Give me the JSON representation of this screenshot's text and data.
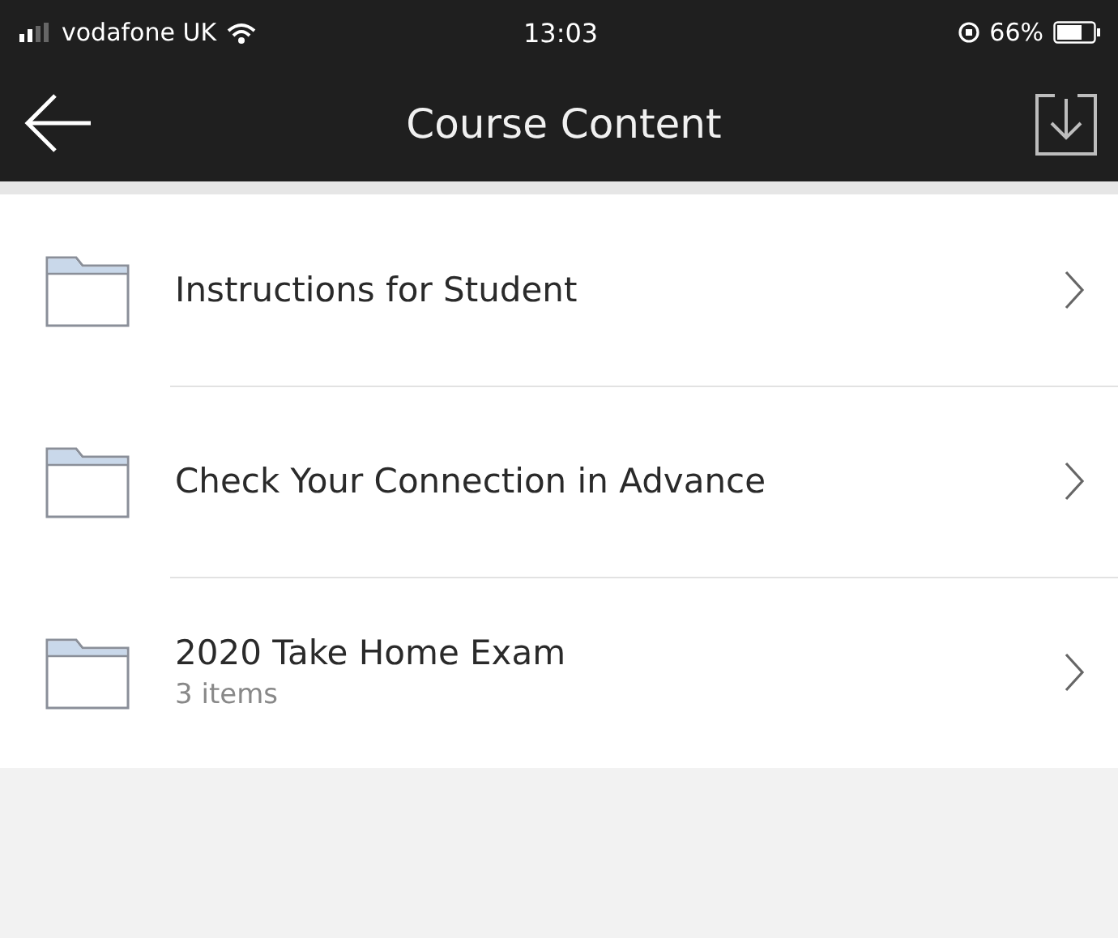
{
  "status_bar": {
    "carrier": "vodafone UK",
    "time": "13:03",
    "battery": "66%"
  },
  "nav_bar": {
    "title": "Course Content"
  },
  "items": [
    {
      "title": "Instructions for Student"
    },
    {
      "title": "Check Your Connection in Advance"
    },
    {
      "title": "2020 Take Home Exam",
      "subtitle": "3 items"
    }
  ]
}
